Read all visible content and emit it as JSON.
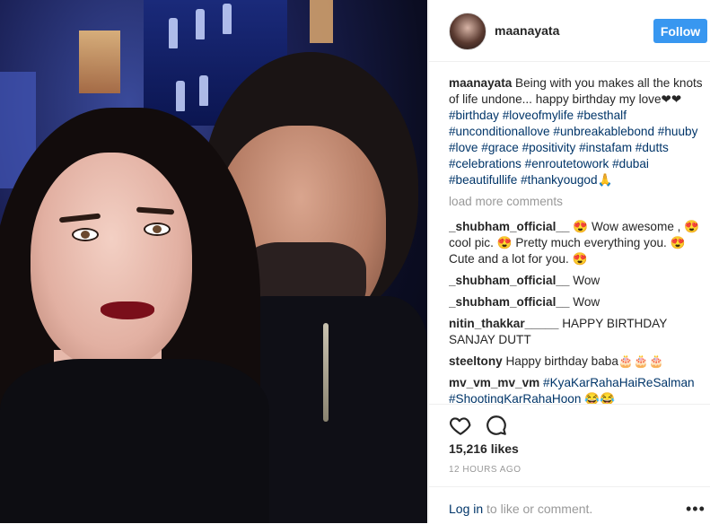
{
  "post": {
    "username": "maanayata",
    "follow_label": "Follow",
    "caption_user": "maanayata",
    "caption_text": " Being with you makes all the knots of life undone... happy birthday my love❤❤",
    "hashtags_a": "#birthday #loveofmylife #besthalf #unconditionallove #unbreakablebond #huuby #love #grace #positivity #instafam #dutts #celebrations #enroutetowork #dubai #beautifullife #thankyougod",
    "caption_tail": "🙏",
    "load_more": "load more comments"
  },
  "comments": [
    {
      "user": "_shubham_official__",
      "text": " 😍 Wow awesome , 😍 cool pic. 😍 Pretty much everything you. 😍 Cute and a lot for you. 😍"
    },
    {
      "user": "_shubham_official__",
      "text": " Wow"
    },
    {
      "user": "_shubham_official__",
      "text": " Wow"
    },
    {
      "user": "nitin_thakkar_____",
      "text": " HAPPY BIRTHDAY SANJAY DUTT"
    },
    {
      "user": "steeltony",
      "text": " Happy birthday baba🎂🎂🎂"
    },
    {
      "user": "mv_vm_mv_vm",
      "text": " #KyaKarRahaHaiReSalman #ShootingKarRahaHoon 😂😂"
    }
  ],
  "actions": {
    "like_icon": "heart-icon",
    "comment_icon": "comment-bubble-icon"
  },
  "stats": {
    "likes": "15,216 likes",
    "time": "12 HOURS AGO"
  },
  "footer": {
    "login_link": "Log in",
    "login_rest": " to like or comment.",
    "more_icon": "•••"
  },
  "colors": {
    "follow_bg": "#3897f0",
    "hashtag": "#003569"
  }
}
